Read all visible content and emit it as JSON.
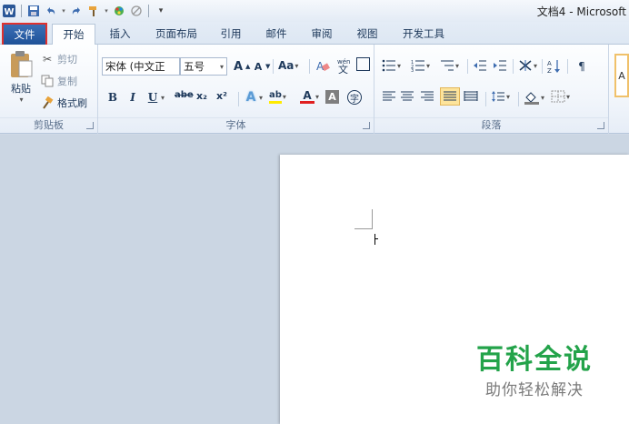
{
  "window": {
    "title": "文档4 - Microsoft"
  },
  "qat": {
    "sep_glyph": "|",
    "more_glyph": "▾"
  },
  "tabs": [
    {
      "label": "文件"
    },
    {
      "label": "开始"
    },
    {
      "label": "插入"
    },
    {
      "label": "页面布局"
    },
    {
      "label": "引用"
    },
    {
      "label": "邮件"
    },
    {
      "label": "审阅"
    },
    {
      "label": "视图"
    },
    {
      "label": "开发工具"
    }
  ],
  "clipboard": {
    "paste_label": "粘贴",
    "cut_label": "剪切",
    "copy_label": "复制",
    "format_painter_label": "格式刷",
    "group_label": "剪贴板"
  },
  "font": {
    "font_name": "宋体 (中文正 ",
    "font_size": "五号",
    "grow_label": "A",
    "shrink_label": "A",
    "case_label": "Aa",
    "clear_label": "A",
    "bold": "B",
    "italic": "I",
    "underline": "U",
    "strike": "abe",
    "subscript": "x₂",
    "superscript": "x²",
    "effects": "A",
    "highlight": "ab",
    "color": "A",
    "char_shading": "A",
    "enclose": "字",
    "phonetic": "wén",
    "border": "A",
    "group_label": "字体"
  },
  "paragraph": {
    "group_label": "段落"
  },
  "styles": {
    "preview": "A"
  },
  "watermark": {
    "title": "百科全说",
    "subtitle": "助你轻松解决"
  },
  "colors": {
    "file_tab": "#2b5797",
    "highlight_border": "#e0312e",
    "watermark_green": "#23a34a"
  }
}
